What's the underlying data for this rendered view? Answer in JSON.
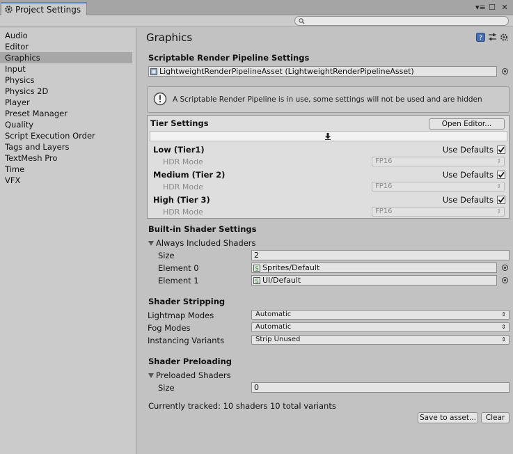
{
  "window": {
    "tab_title": "Project Settings",
    "controls": [
      "menu-icon",
      "maximize-icon",
      "close-icon"
    ]
  },
  "search": {
    "placeholder": "",
    "value": ""
  },
  "sidebar": {
    "items": [
      {
        "label": "Audio",
        "active": false
      },
      {
        "label": "Editor",
        "active": false
      },
      {
        "label": "Graphics",
        "active": true
      },
      {
        "label": "Input",
        "active": false
      },
      {
        "label": "Physics",
        "active": false
      },
      {
        "label": "Physics 2D",
        "active": false
      },
      {
        "label": "Player",
        "active": false
      },
      {
        "label": "Preset Manager",
        "active": false
      },
      {
        "label": "Quality",
        "active": false
      },
      {
        "label": "Script Execution Order",
        "active": false
      },
      {
        "label": "Tags and Layers",
        "active": false
      },
      {
        "label": "TextMesh Pro",
        "active": false
      },
      {
        "label": "Time",
        "active": false
      },
      {
        "label": "VFX",
        "active": false
      }
    ]
  },
  "main": {
    "title": "Graphics",
    "header_icons": [
      "help-icon",
      "preset-icon",
      "settings-gear-icon"
    ],
    "srp": {
      "heading": "Scriptable Render Pipeline Settings",
      "asset": "LightweightRenderPipelineAsset (LightweightRenderPipelineAsset)",
      "help_text": "A Scriptable Render Pipeline is in use, some settings will not be used and are hidden"
    },
    "tiers": {
      "heading": "Tier Settings",
      "open_editor_label": "Open Editor...",
      "rows": [
        {
          "name": "Low (Tier1)",
          "use_defaults_label": "Use Defaults",
          "use_defaults": true,
          "sub_label": "HDR Mode",
          "sub_value": "FP16"
        },
        {
          "name": "Medium (Tier 2)",
          "use_defaults_label": "Use Defaults",
          "use_defaults": true,
          "sub_label": "HDR Mode",
          "sub_value": "FP16"
        },
        {
          "name": "High (Tier 3)",
          "use_defaults_label": "Use Defaults",
          "use_defaults": true,
          "sub_label": "HDR Mode",
          "sub_value": "FP16"
        }
      ]
    },
    "builtin": {
      "heading": "Built-in Shader Settings",
      "foldout": "Always Included Shaders",
      "size_label": "Size",
      "size_value": "2",
      "elements": [
        {
          "label": "Element 0",
          "value": "Sprites/Default"
        },
        {
          "label": "Element 1",
          "value": "UI/Default"
        }
      ]
    },
    "stripping": {
      "heading": "Shader Stripping",
      "rows": [
        {
          "label": "Lightmap Modes",
          "value": "Automatic"
        },
        {
          "label": "Fog Modes",
          "value": "Automatic"
        },
        {
          "label": "Instancing Variants",
          "value": "Strip Unused"
        }
      ]
    },
    "preloading": {
      "heading": "Shader Preloading",
      "foldout": "Preloaded Shaders",
      "size_label": "Size",
      "size_value": "0",
      "status": "Currently tracked: 10 shaders 10 total variants",
      "save_label": "Save to asset...",
      "clear_label": "Clear"
    }
  }
}
